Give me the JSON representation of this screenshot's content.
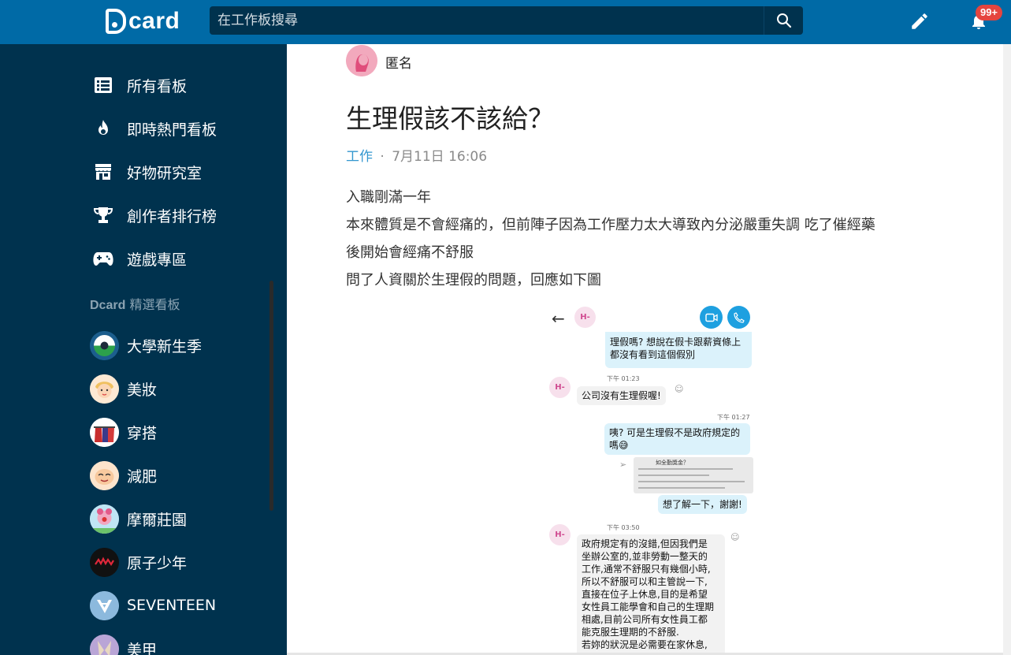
{
  "header": {
    "logo_text": "card",
    "search_placeholder": "在工作板搜尋",
    "notification_count": "99+"
  },
  "sidebar": {
    "nav": [
      {
        "label": "所有看板",
        "icon": "list-icon"
      },
      {
        "label": "即時熱門看板",
        "icon": "flame-icon"
      },
      {
        "label": "好物研究室",
        "icon": "store-icon"
      },
      {
        "label": "創作者排行榜",
        "icon": "trophy-icon"
      },
      {
        "label": "遊戲專區",
        "icon": "gamepad-icon"
      }
    ],
    "section_title_brand": "Dcard",
    "section_title_rest": " 精選看板",
    "boards": [
      {
        "label": "大學新生季"
      },
      {
        "label": "美妝"
      },
      {
        "label": "穿搭"
      },
      {
        "label": "減肥"
      },
      {
        "label": "摩爾莊園"
      },
      {
        "label": "原子少年"
      },
      {
        "label": "SEVENTEEN"
      },
      {
        "label": "美甲"
      }
    ]
  },
  "post": {
    "author": "匿名",
    "title": "生理假該不該給？",
    "forum": "工作",
    "separator": "·",
    "date": "7月11日 16:06",
    "body": [
      "入職剛滿一年",
      "本來體質是不會經痛的，但前陣子因為工作壓力太大導致內分泌嚴重失調 吃了催經藥",
      "後開始會經痛不舒服",
      "問了人資關於生理假的問題，回應如下圖"
    ]
  },
  "chat": {
    "contact": "H-",
    "msg1": [
      "理假嗎? 想說在假卡跟薪資條上",
      "都沒有看到這個假別"
    ],
    "time1": "下午 01:23",
    "msg2": "公司沒有生理假喔!",
    "time2": "下午 01:27",
    "msg3": [
      "咦? 可是生理假不是政府規定的",
      "嗎😅"
    ],
    "img_title": "如全勤獎金？",
    "msg4": "想了解一下，謝謝!",
    "time3": "下午 03:50",
    "msg5": [
      "政府規定有的沒錯,但因我們是",
      "坐辦公室的,並非勞動一整天的",
      "工作,通常不舒服只有幾個小時,",
      "所以不舒服可以和主管說一下,",
      "直接在位子上休息,目的是希望",
      "女性員工能學會和自己的生理期",
      "相處,目前公司所有女性員工都",
      "能克服生理期的不舒服.",
      "若妳的狀況是必需要在家休息,"
    ]
  }
}
